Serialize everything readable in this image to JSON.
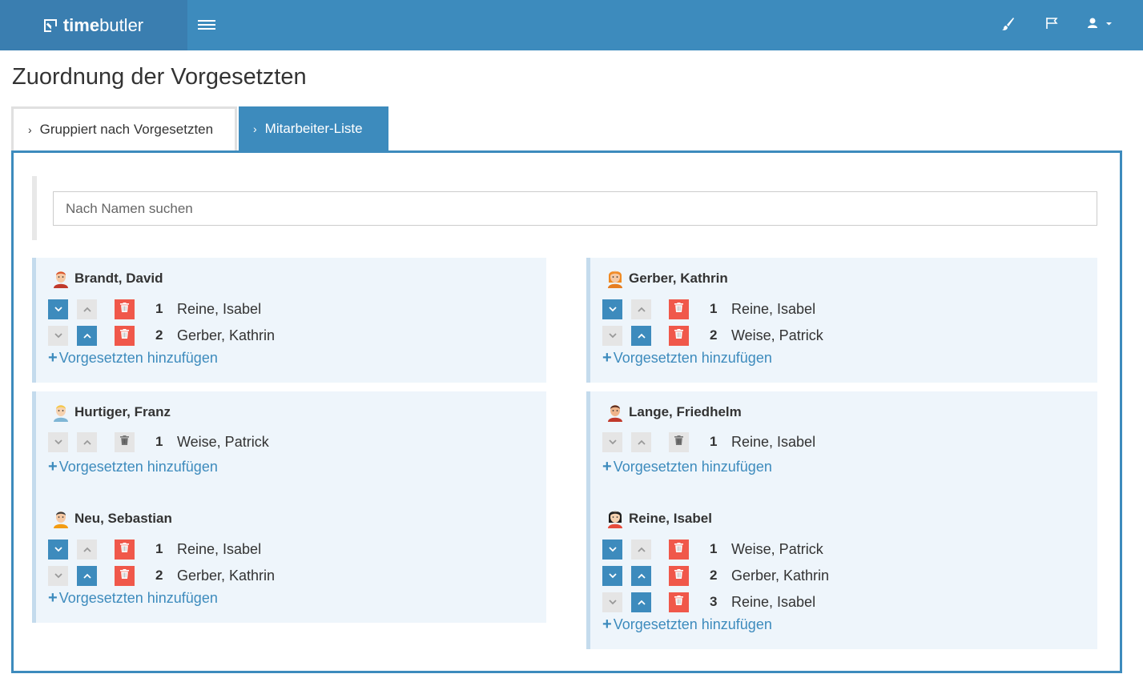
{
  "app": {
    "brand_bold": "time",
    "brand_light": "butler"
  },
  "page": {
    "title": "Zuordnung der Vorgesetzten"
  },
  "tabs": [
    {
      "label": "Gruppiert nach Vorgesetzten",
      "active": false
    },
    {
      "label": "Mitarbeiter-Liste",
      "active": true
    }
  ],
  "search": {
    "placeholder": "Nach Namen suchen",
    "value": ""
  },
  "add_label": "Vorgesetzten hinzufügen",
  "colors": {
    "accent": "#3d8bbd",
    "delete": "#f0584a",
    "card_bg": "#eef5fb"
  },
  "employees": [
    {
      "name": "Brandt, David",
      "avatar": "male-redhair-avatar",
      "supervisors": [
        {
          "rank": "1",
          "name": "Reine, Isabel",
          "down": true,
          "up": false,
          "delete": true
        },
        {
          "rank": "2",
          "name": "Gerber, Kathrin",
          "down": false,
          "up": true,
          "delete": true
        }
      ]
    },
    {
      "name": "Gerber, Kathrin",
      "avatar": "female-orangehair-avatar",
      "supervisors": [
        {
          "rank": "1",
          "name": "Reine, Isabel",
          "down": true,
          "up": false,
          "delete": true
        },
        {
          "rank": "2",
          "name": "Weise, Patrick",
          "down": false,
          "up": true,
          "delete": true
        }
      ]
    },
    {
      "name": "Hurtiger, Franz",
      "avatar": "male-blondhair-avatar",
      "supervisors": [
        {
          "rank": "1",
          "name": "Weise, Patrick",
          "down": false,
          "up": false,
          "delete": false
        }
      ]
    },
    {
      "name": "Lange, Friedhelm",
      "avatar": "male-beard-avatar",
      "supervisors": [
        {
          "rank": "1",
          "name": "Reine, Isabel",
          "down": false,
          "up": false,
          "delete": false
        }
      ]
    },
    {
      "name": "Neu, Sebastian",
      "avatar": "male-darkhair-avatar",
      "supervisors": [
        {
          "rank": "1",
          "name": "Reine, Isabel",
          "down": true,
          "up": false,
          "delete": true
        },
        {
          "rank": "2",
          "name": "Gerber, Kathrin",
          "down": false,
          "up": true,
          "delete": true
        }
      ]
    },
    {
      "name": "Reine, Isabel",
      "avatar": "female-blackhair-avatar",
      "supervisors": [
        {
          "rank": "1",
          "name": "Weise, Patrick",
          "down": true,
          "up": false,
          "delete": true
        },
        {
          "rank": "2",
          "name": "Gerber, Kathrin",
          "down": true,
          "up": true,
          "delete": true
        },
        {
          "rank": "3",
          "name": "Reine, Isabel",
          "down": false,
          "up": true,
          "delete": true
        }
      ]
    }
  ]
}
